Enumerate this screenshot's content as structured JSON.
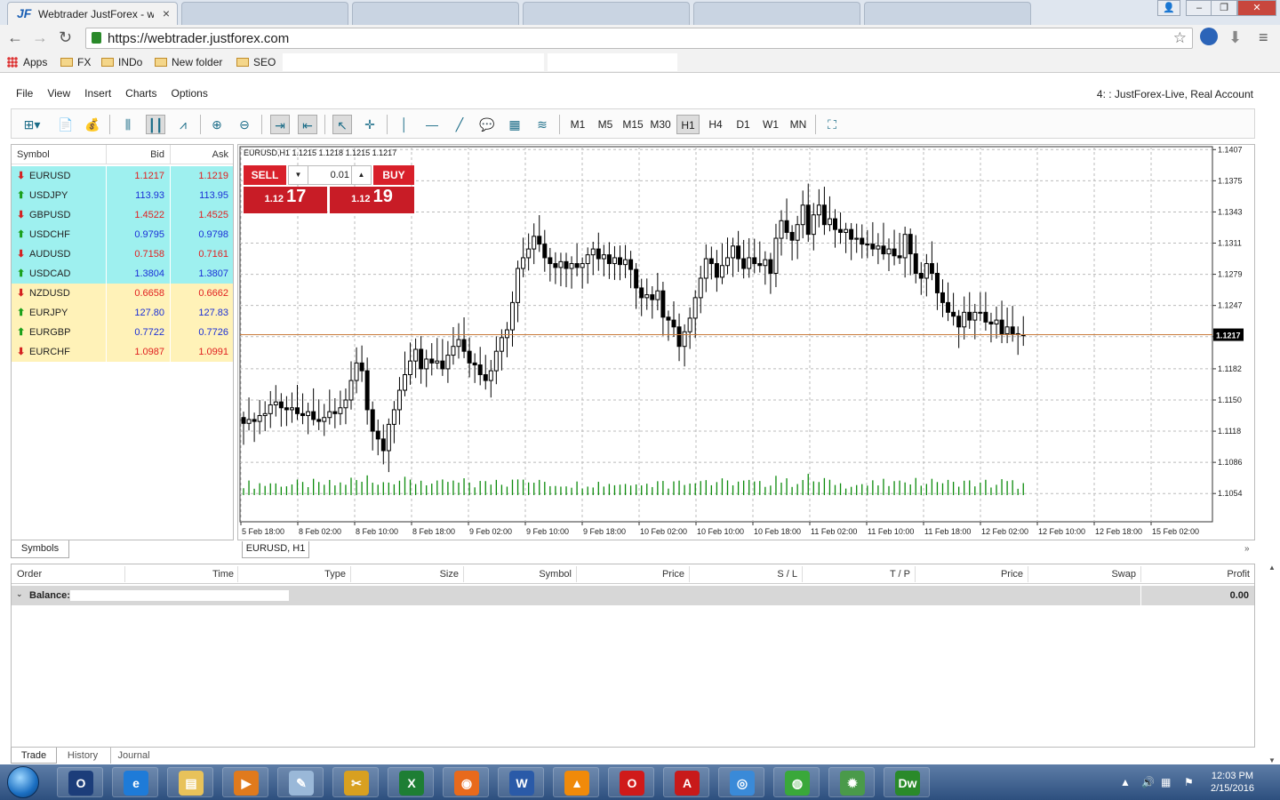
{
  "browser": {
    "tabs": [
      {
        "title": "Webtrader JustForex - we",
        "active": true
      },
      {
        "title": "",
        "active": false
      },
      {
        "title": "",
        "active": false
      },
      {
        "title": "",
        "active": false
      },
      {
        "title": "",
        "active": false
      },
      {
        "title": "",
        "active": false
      },
      {
        "title": "",
        "active": false
      }
    ],
    "url": "https://webtrader.justforex.com",
    "bookmarks": [
      "Apps",
      "FX",
      "INDo",
      "New folder",
      "SEO"
    ]
  },
  "menu": [
    "File",
    "View",
    "Insert",
    "Charts",
    "Options"
  ],
  "account": "4:      : JustForex-Live, Real Account",
  "timeframes": [
    "M1",
    "M5",
    "M15",
    "M30",
    "H1",
    "H4",
    "D1",
    "W1",
    "MN"
  ],
  "active_timeframe": "H1",
  "market_watch": {
    "headers": {
      "symbol": "Symbol",
      "bid": "Bid",
      "ask": "Ask"
    },
    "rows": [
      {
        "symbol": "EURUSD",
        "bid": "1.1217",
        "ask": "1.1219",
        "dir": "down",
        "bg": "cyan"
      },
      {
        "symbol": "USDJPY",
        "bid": "113.93",
        "ask": "113.95",
        "dir": "up",
        "bg": "cyan"
      },
      {
        "symbol": "GBPUSD",
        "bid": "1.4522",
        "ask": "1.4525",
        "dir": "down",
        "bg": "cyan"
      },
      {
        "symbol": "USDCHF",
        "bid": "0.9795",
        "ask": "0.9798",
        "dir": "up",
        "bg": "cyan"
      },
      {
        "symbol": "AUDUSD",
        "bid": "0.7158",
        "ask": "0.7161",
        "dir": "down",
        "bg": "cyan"
      },
      {
        "symbol": "USDCAD",
        "bid": "1.3804",
        "ask": "1.3807",
        "dir": "up",
        "bg": "cyan"
      },
      {
        "symbol": "NZDUSD",
        "bid": "0.6658",
        "ask": "0.6662",
        "dir": "down",
        "bg": "yellow"
      },
      {
        "symbol": "EURJPY",
        "bid": "127.80",
        "ask": "127.83",
        "dir": "up",
        "bg": "yellow"
      },
      {
        "symbol": "EURGBP",
        "bid": "0.7722",
        "ask": "0.7726",
        "dir": "up",
        "bg": "yellow"
      },
      {
        "symbol": "EURCHF",
        "bid": "1.0987",
        "ask": "1.0991",
        "dir": "down",
        "bg": "yellow"
      }
    ],
    "tab": "Symbols"
  },
  "one_click": {
    "sell_label": "SELL",
    "buy_label": "BUY",
    "lot": "0.01",
    "sell_prefix": "1.12",
    "sell_pips": "17",
    "buy_prefix": "1.12",
    "buy_pips": "19"
  },
  "chart": {
    "header": "EURUSD,H1  1.1215 1.1218 1.1215 1.1217",
    "tab_label": "EURUSD, H1",
    "current_price": "1.1217",
    "price_ticks": [
      "1.1407",
      "1.1375",
      "1.1343",
      "1.1311",
      "1.1279",
      "1.1247",
      "1.1215",
      "1.1182",
      "1.1150",
      "1.1118",
      "1.1086",
      "1.1054"
    ],
    "time_ticks": [
      "5 Feb 18:00",
      "8 Feb 02:00",
      "8 Feb 10:00",
      "8 Feb 18:00",
      "9 Feb 02:00",
      "9 Feb 10:00",
      "9 Feb 18:00",
      "10 Feb 02:00",
      "10 Feb 10:00",
      "10 Feb 18:00",
      "11 Feb 02:00",
      "11 Feb 10:00",
      "11 Feb 18:00",
      "12 Feb 02:00",
      "12 Feb 10:00",
      "12 Feb 18:00",
      "15 Feb 02:00"
    ]
  },
  "chart_data": {
    "type": "candlestick",
    "title": "EURUSD,H1",
    "ylim": [
      1.1025,
      1.141
    ],
    "closes": [
      1.1126,
      1.113,
      1.1128,
      1.1134,
      1.1136,
      1.1145,
      1.1148,
      1.1142,
      1.114,
      1.1142,
      1.1136,
      1.1134,
      1.1138,
      1.113,
      1.1128,
      1.1132,
      1.1138,
      1.1136,
      1.1142,
      1.115,
      1.117,
      1.1188,
      1.118,
      1.114,
      1.1118,
      1.111,
      1.1098,
      1.1125,
      1.114,
      1.116,
      1.1176,
      1.119,
      1.1202,
      1.1182,
      1.1192,
      1.1188,
      1.119,
      1.1182,
      1.1196,
      1.1205,
      1.1212,
      1.12,
      1.1188,
      1.1186,
      1.1176,
      1.117,
      1.118,
      1.12,
      1.1214,
      1.1222,
      1.125,
      1.1285,
      1.1296,
      1.1305,
      1.1318,
      1.131,
      1.1296,
      1.129,
      1.1286,
      1.1292,
      1.1285,
      1.129,
      1.1286,
      1.129,
      1.1299,
      1.1305,
      1.1295,
      1.1299,
      1.129,
      1.1296,
      1.1289,
      1.1294,
      1.1284,
      1.1265,
      1.1255,
      1.1258,
      1.1253,
      1.1262,
      1.1235,
      1.1232,
      1.1225,
      1.1205,
      1.122,
      1.1234,
      1.1255,
      1.1275,
      1.1295,
      1.129,
      1.1276,
      1.1288,
      1.1296,
      1.1308,
      1.1295,
      1.1285,
      1.1296,
      1.129,
      1.1288,
      1.1294,
      1.128,
      1.1316,
      1.1334,
      1.1322,
      1.1314,
      1.133,
      1.135,
      1.132,
      1.134,
      1.135,
      1.133,
      1.1336,
      1.1325,
      1.1322,
      1.1325,
      1.1315,
      1.1316,
      1.131,
      1.131,
      1.1305,
      1.1308,
      1.13,
      1.1305,
      1.1298,
      1.1296,
      1.132,
      1.13,
      1.128,
      1.1275,
      1.129,
      1.128,
      1.126,
      1.125,
      1.124,
      1.1236,
      1.1225,
      1.124,
      1.1232,
      1.124,
      1.124,
      1.123,
      1.1228,
      1.1232,
      1.1218,
      1.1225,
      1.1218,
      1.1217,
      1.1216
    ],
    "volume_note": "volume histogram bars shown in green"
  },
  "terminal": {
    "headers": [
      "Order",
      "Time",
      "Type",
      "Size",
      "Symbol",
      "Price",
      "S / L",
      "T / P",
      "Price",
      "Swap",
      "Profit"
    ],
    "balance_label": "Balance:",
    "profit": "0.00",
    "tabs": [
      "Trade",
      "History",
      "Journal"
    ],
    "active_tab": "Trade"
  },
  "taskbar": {
    "time": "12:03 PM",
    "date": "2/15/2016",
    "apps": [
      "outlook",
      "ie",
      "explorer",
      "media",
      "notepad",
      "tool",
      "excel",
      "firefox",
      "word",
      "vlc",
      "opera",
      "acrobat",
      "chrome",
      "globe",
      "network",
      "dreamweaver"
    ]
  },
  "colors": {
    "accent_red": "#d8202a",
    "cyan_row": "#9ef0ef",
    "yellow_row": "#fff2b8",
    "bid_red": "#e02020",
    "bid_blue": "#1a2fd6",
    "volume_green": "#0a8a0a",
    "price_line": "#c87a3a"
  }
}
